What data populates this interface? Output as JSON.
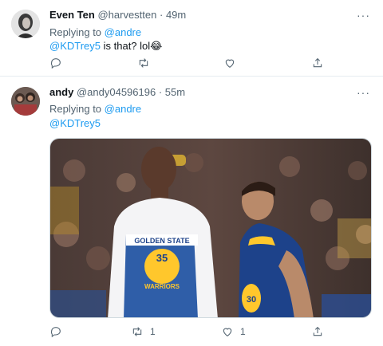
{
  "tweets": [
    {
      "name": "Even Ten",
      "handle": "@harvestten",
      "time": "49m",
      "replying_prefix": "Replying to",
      "replying_to": "@andre",
      "mention": "@KDTrey5",
      "body": " is that?  lol",
      "emoji": "😂",
      "counts": {
        "reply": "",
        "retweet": "",
        "like": ""
      }
    },
    {
      "name": "andy",
      "handle": "@andy04596196",
      "time": "55m",
      "replying_prefix": "Replying to",
      "replying_to": "@andre",
      "mention": "@KDTrey5",
      "jersey_left": {
        "team": "GOLDEN STATE",
        "number": "35",
        "subtext": "WARRIORS"
      },
      "jersey_right": {
        "number": "30"
      },
      "counts": {
        "reply": "",
        "retweet": "1",
        "like": "1"
      }
    }
  ],
  "separator": " · ",
  "more_icon": "···",
  "colors": {
    "link": "#1d9bf0",
    "muted": "#536471",
    "warriors_blue": "#1d428a",
    "warriors_gold": "#ffc72c"
  }
}
